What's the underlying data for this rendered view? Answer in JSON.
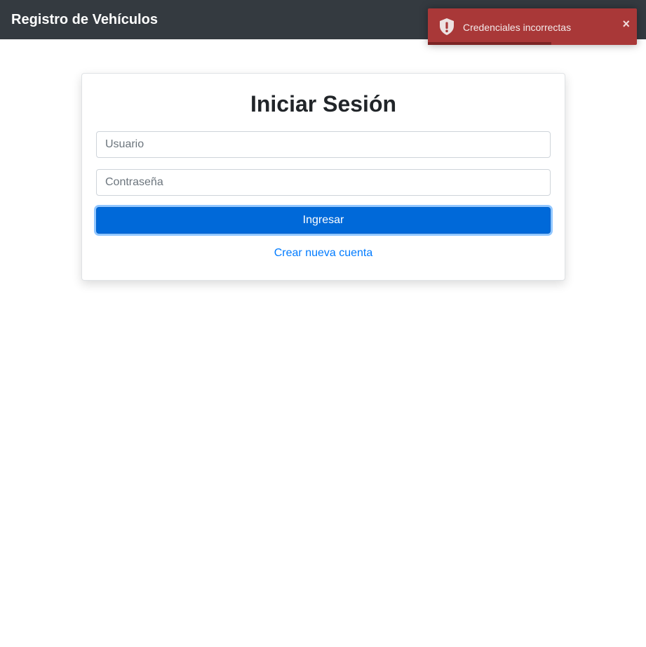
{
  "navbar": {
    "brand": "Registro de Vehículos"
  },
  "login": {
    "title": "Iniciar Sesión",
    "username_placeholder": "Usuario",
    "username_value": "",
    "password_placeholder": "Contraseña",
    "password_value": "",
    "submit_label": "Ingresar",
    "create_account_label": "Crear nueva cuenta"
  },
  "toast": {
    "type": "error",
    "icon": "shield-alert-icon",
    "message": "Credenciales incorrectas",
    "close_label": "×",
    "progress": 0.59,
    "color": "#a93838"
  },
  "colors": {
    "navbar_bg": "#343a40",
    "primary": "#0069d9",
    "link": "#007bff",
    "toast_error": "#a93838"
  }
}
